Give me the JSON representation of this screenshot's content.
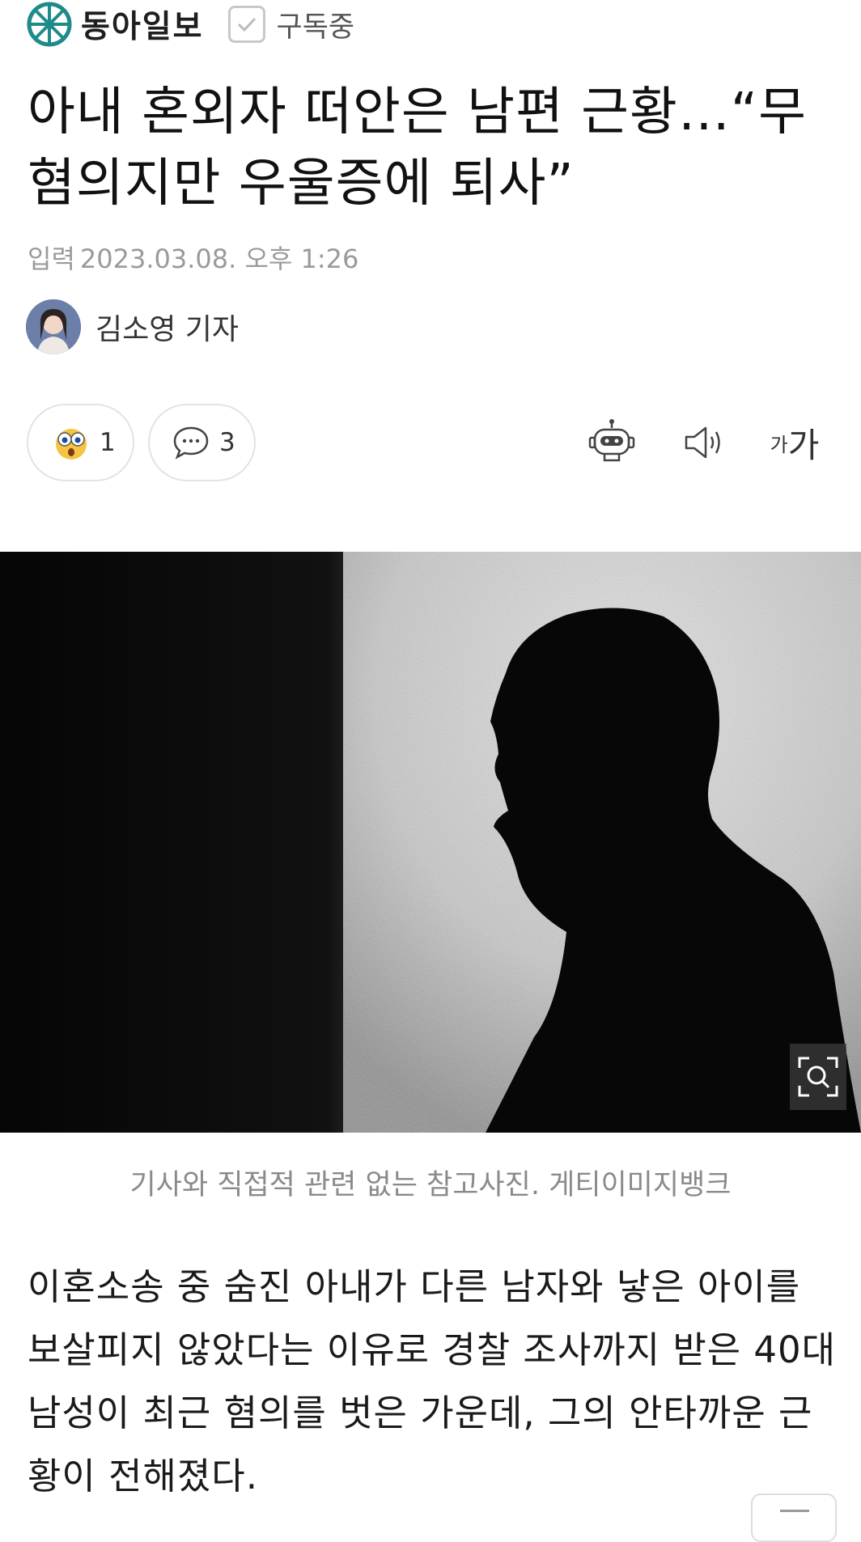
{
  "header": {
    "press_name": "동아일보",
    "subscribe_label": "구독중",
    "logo_icon": "donga-wheel-logo",
    "brand_color": "#1f8a8a"
  },
  "article": {
    "title": "아내 혼외자 떠안은 남편 근황…“무혐의지만 우울증에 퇴사”",
    "publish_label": "입력",
    "publish_time": "2023.03.08. 오후 1:26",
    "reporter": "김소영 기자"
  },
  "actions": {
    "reaction_icon": "surprised-face-icon",
    "reaction_count": "1",
    "comment_icon": "comment-bubble-icon",
    "comment_count": "3",
    "tools": [
      "robot-summary-icon",
      "speaker-icon",
      "font-size-icon"
    ],
    "font_small": "가",
    "font_large": "가"
  },
  "photo": {
    "caption": "기사와 직접적 관련 없는 참고사진. 게티이미지뱅크",
    "zoom_icon": "zoom-search-icon"
  },
  "body": {
    "paragraph": "이혼소송 중 숨진 아내가 다른 남자와 낳은 아이를 보살피지 않았다는 이유로 경찰 조사까지 받은 40대 남성이 최근 혐의를 벗은 가운데, 그의 안타까운 근황이 전해졌다."
  }
}
